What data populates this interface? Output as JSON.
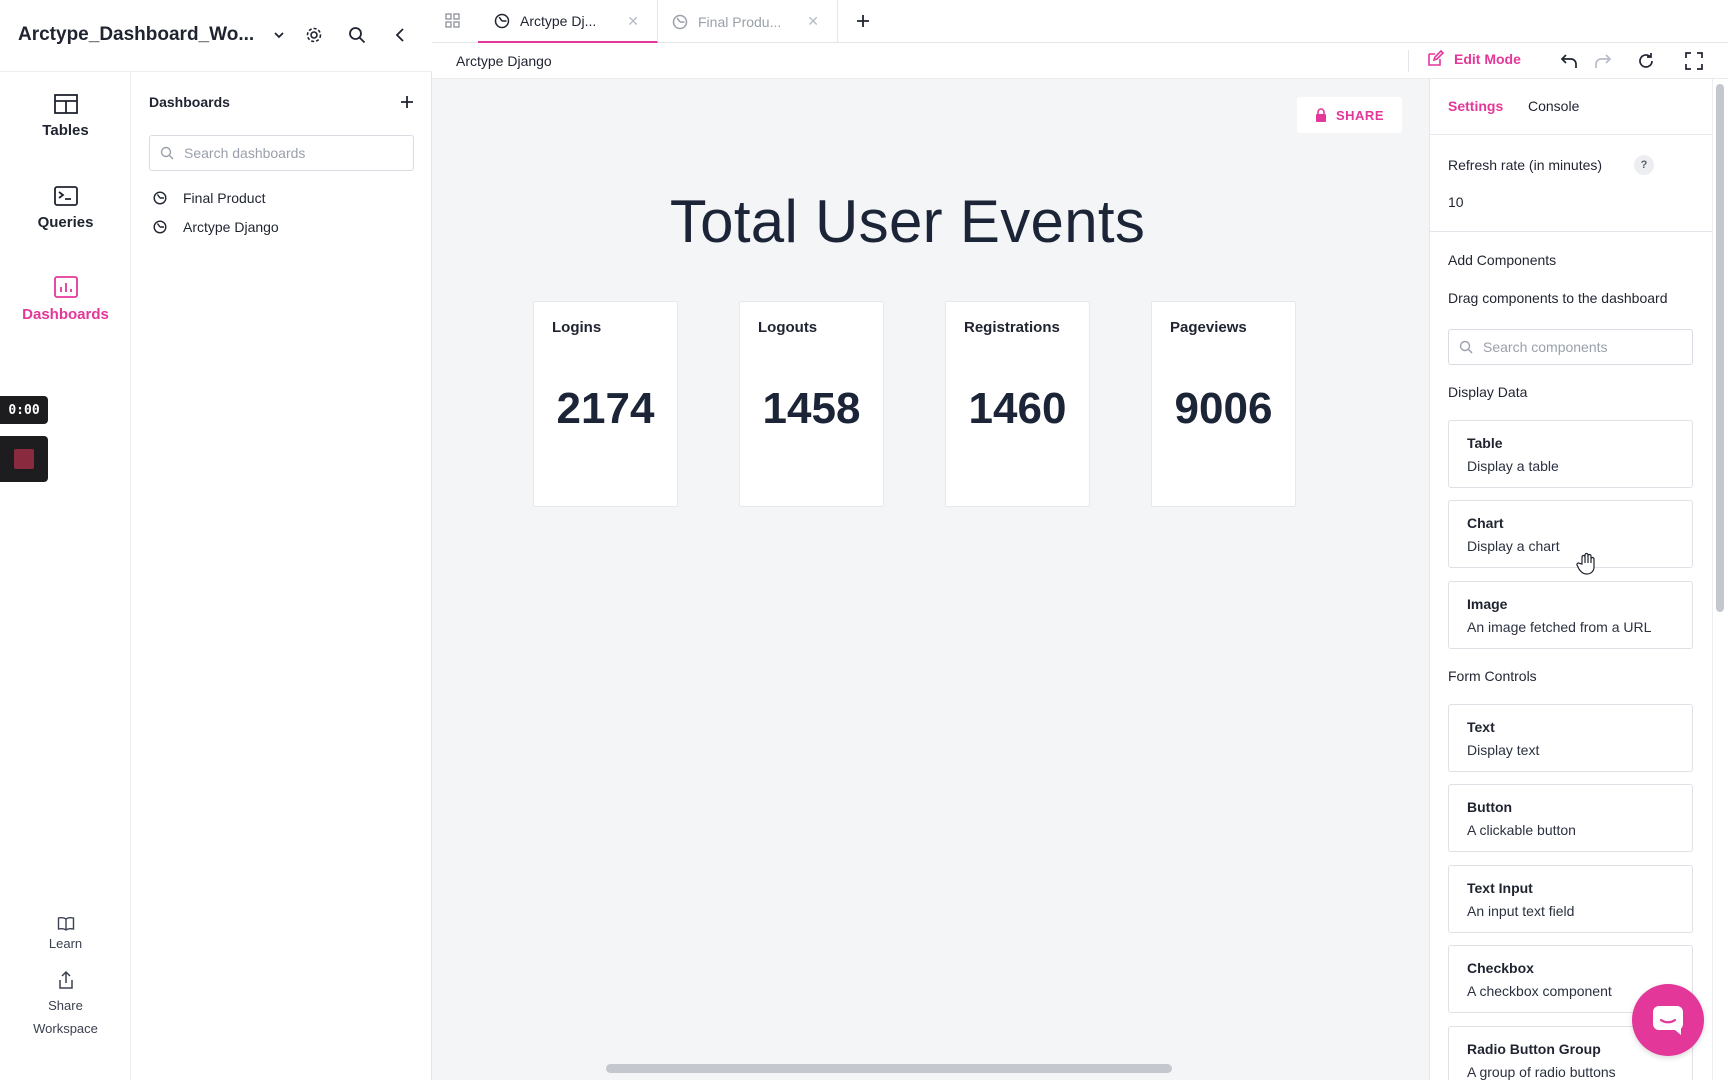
{
  "workspace": {
    "title": "Arctype_Dashboard_Wo..."
  },
  "nav": {
    "items": [
      {
        "label": "Tables",
        "icon": "tables-icon"
      },
      {
        "label": "Queries",
        "icon": "terminal-icon"
      },
      {
        "label": "Dashboards",
        "icon": "bar-chart-icon",
        "active": true
      }
    ],
    "learn_label": "Learn",
    "share_line1": "Share",
    "share_line2": "Workspace"
  },
  "recording": {
    "time": "0:00"
  },
  "dashboards_panel": {
    "title": "Dashboards",
    "search_placeholder": "Search dashboards",
    "items": [
      {
        "label": "Final Product"
      },
      {
        "label": "Arctype Django"
      }
    ]
  },
  "tabs": [
    {
      "label": "Arctype Dj...",
      "active": true
    },
    {
      "label": "Final Produ...",
      "active": false
    }
  ],
  "toolbar": {
    "breadcrumb": "Arctype Django",
    "edit_mode_label": "Edit Mode"
  },
  "canvas": {
    "share_label": "SHARE",
    "title": "Total User Events",
    "stats": [
      {
        "label": "Logins",
        "value": "2174"
      },
      {
        "label": "Logouts",
        "value": "1458"
      },
      {
        "label": "Registrations",
        "value": "1460"
      },
      {
        "label": "Pageviews",
        "value": "9006"
      }
    ]
  },
  "right_panel": {
    "tabs": {
      "settings": "Settings",
      "console": "Console"
    },
    "refresh_label": "Refresh rate (in minutes)",
    "refresh_help": "?",
    "refresh_value": "10",
    "add_components_title": "Add Components",
    "add_components_hint": "Drag components to the dashboard",
    "search_placeholder": "Search components",
    "display_data_title": "Display Data",
    "display_data": [
      {
        "name": "Table",
        "desc": "Display a table"
      },
      {
        "name": "Chart",
        "desc": "Display a chart"
      },
      {
        "name": "Image",
        "desc": "An image fetched from a URL"
      }
    ],
    "form_controls_title": "Form Controls",
    "form_controls": [
      {
        "name": "Text",
        "desc": "Display text"
      },
      {
        "name": "Button",
        "desc": "A clickable button"
      },
      {
        "name": "Text Input",
        "desc": "An input text field"
      },
      {
        "name": "Checkbox",
        "desc": "A checkbox component"
      },
      {
        "name": "Radio Button Group",
        "desc": "A group of radio buttons"
      }
    ]
  },
  "colors": {
    "accent": "#e4379a",
    "text": "#1c2437",
    "canvas_bg": "#f4f5f7"
  }
}
